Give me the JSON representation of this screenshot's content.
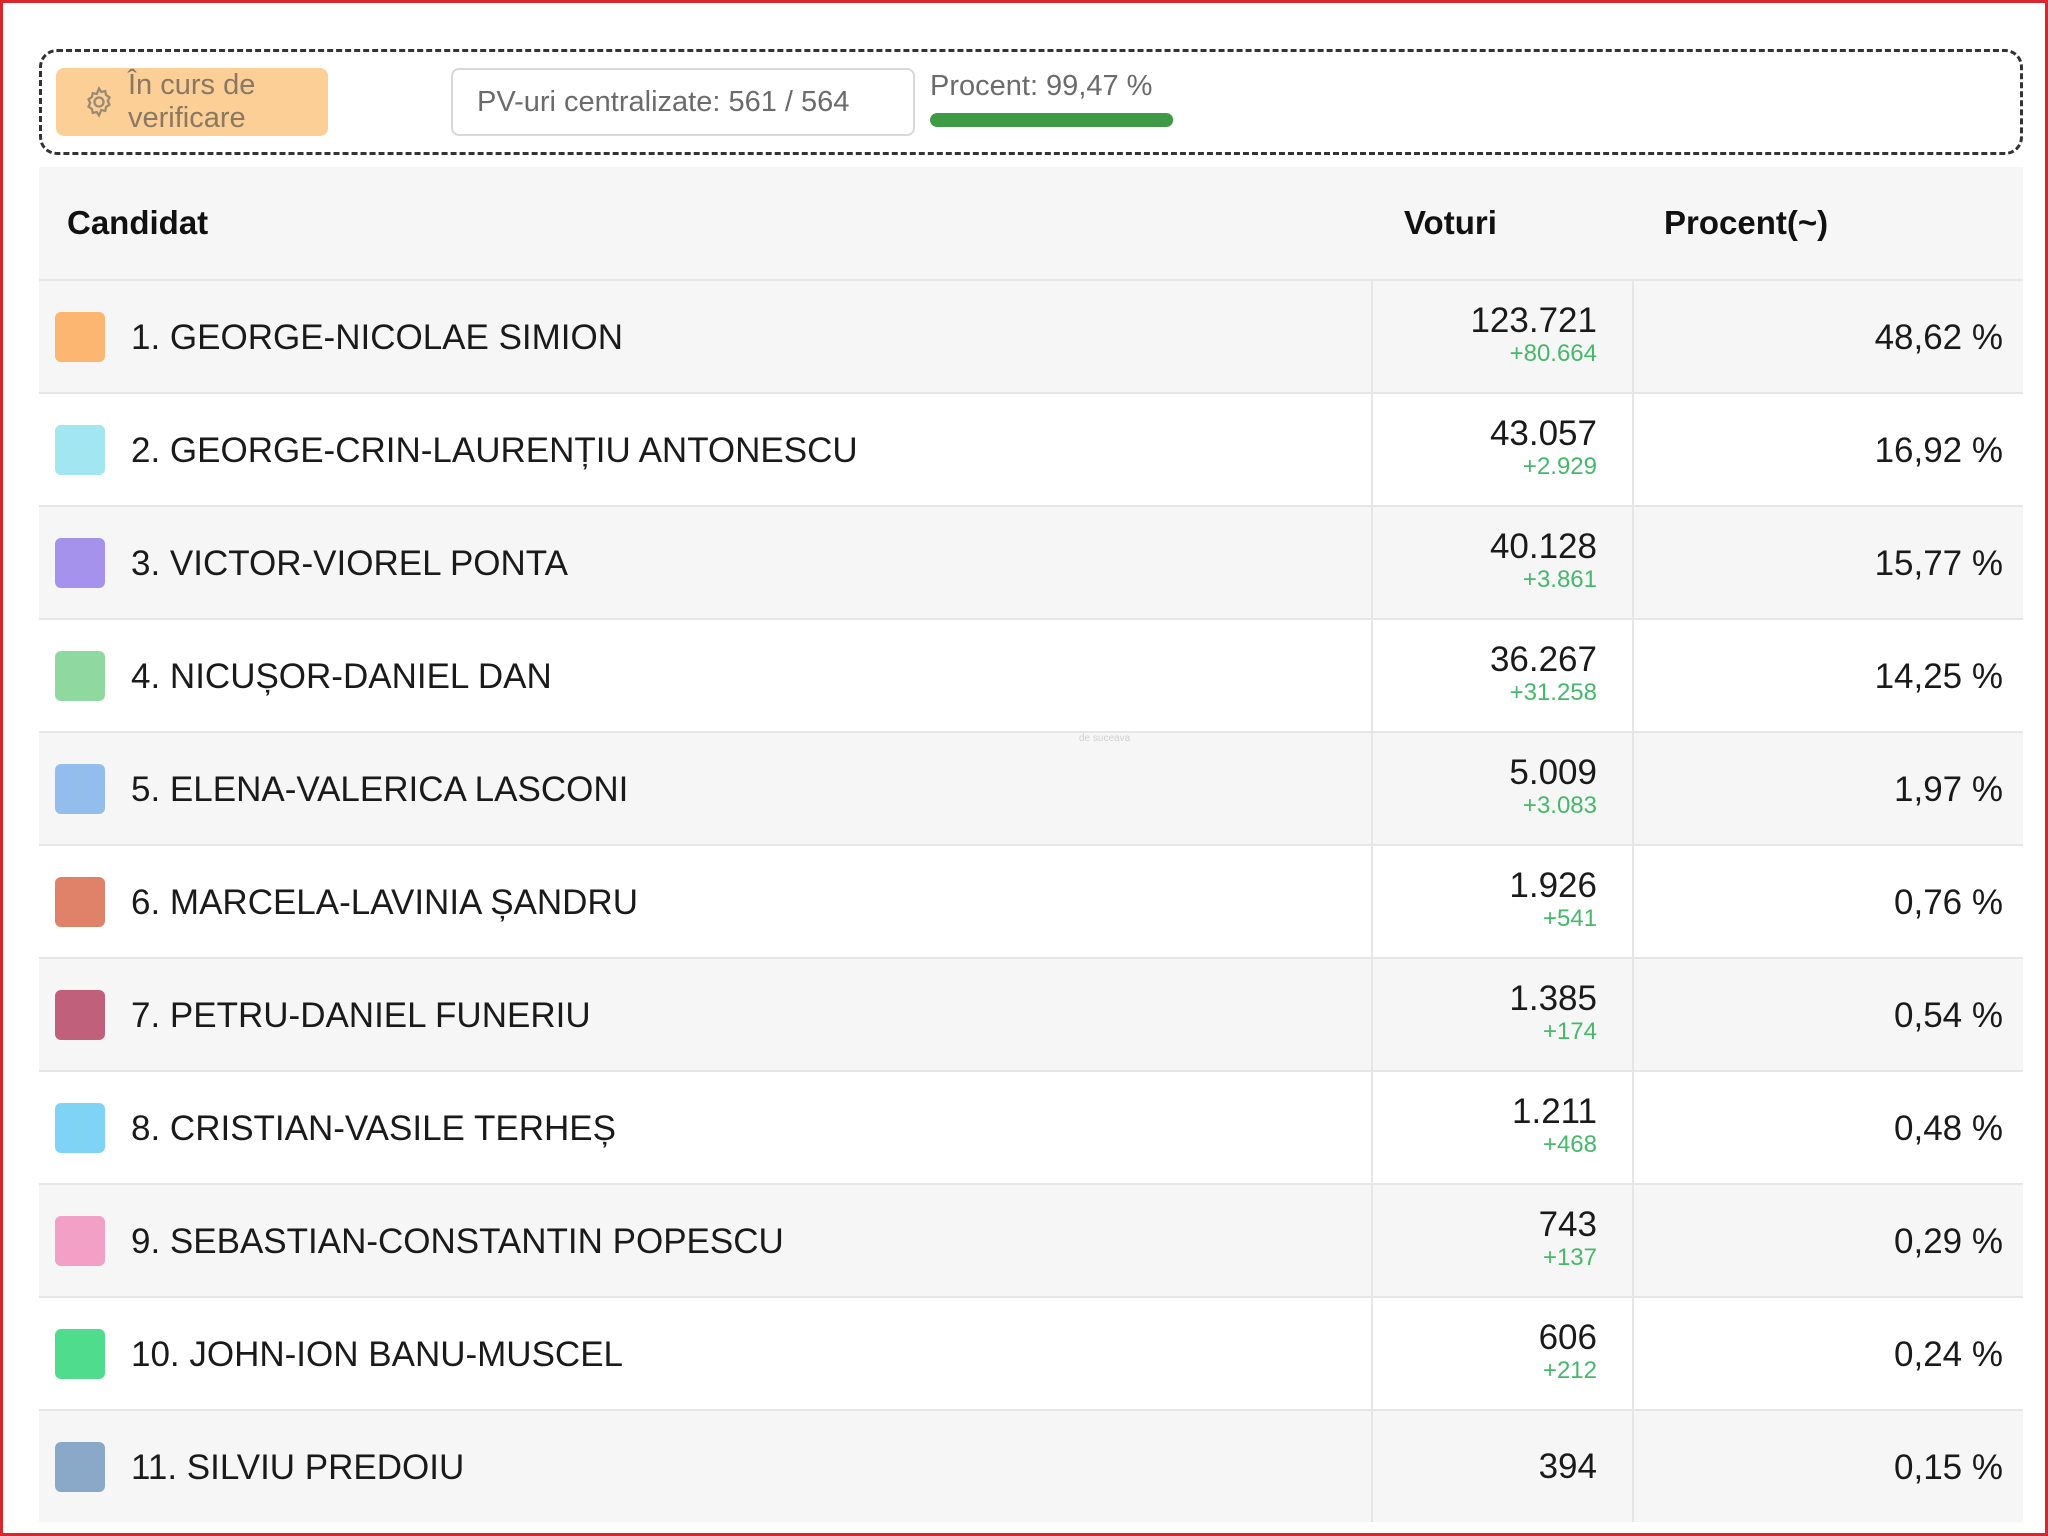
{
  "status": {
    "verify_label": "În curs de verificare",
    "verify_icon": "gear-icon",
    "pv_label": "PV-uri centralizate: 561 / 564",
    "procent_label": "Procent: 99,47 %",
    "procent_value": 0.9947
  },
  "table": {
    "headers": {
      "candidat": "Candidat",
      "voturi": "Voturi",
      "procent": "Procent(~)"
    },
    "rows": [
      {
        "name": "1. GEORGE-NICOLAE SIMION",
        "votes": "123.721",
        "delta": "+80.664",
        "percent": "48,62 %",
        "color": "#fcb672"
      },
      {
        "name": "2. GEORGE-CRIN-LAURENȚIU ANTONESCU",
        "votes": "43.057",
        "delta": "+2.929",
        "percent": "16,92 %",
        "color": "#a2e6f2"
      },
      {
        "name": "3. VICTOR-VIOREL PONTA",
        "votes": "40.128",
        "delta": "+3.861",
        "percent": "15,77 %",
        "color": "#a592ec"
      },
      {
        "name": "4. NICUȘOR-DANIEL DAN",
        "votes": "36.267",
        "delta": "+31.258",
        "percent": "14,25 %",
        "color": "#8fd9a0"
      },
      {
        "name": "5. ELENA-VALERICA LASCONI",
        "votes": "5.009",
        "delta": "+3.083",
        "percent": "1,97 %",
        "color": "#92bdec"
      },
      {
        "name": "6. MARCELA-LAVINIA ȘANDRU",
        "votes": "1.926",
        "delta": "+541",
        "percent": "0,76 %",
        "color": "#e0826a"
      },
      {
        "name": "7. PETRU-DANIEL FUNERIU",
        "votes": "1.385",
        "delta": "+174",
        "percent": "0,54 %",
        "color": "#c0607a"
      },
      {
        "name": "8. CRISTIAN-VASILE TERHEȘ",
        "votes": "1.211",
        "delta": "+468",
        "percent": "0,48 %",
        "color": "#7fd4f6"
      },
      {
        "name": "9. SEBASTIAN-CONSTANTIN POPESCU",
        "votes": "743",
        "delta": "+137",
        "percent": "0,29 %",
        "color": "#f3a0c6"
      },
      {
        "name": "10. JOHN-ION BANU-MUSCEL",
        "votes": "606",
        "delta": "+212",
        "percent": "0,24 %",
        "color": "#4fdc8c"
      },
      {
        "name": "11. SILVIU PREDOIU",
        "votes": "394",
        "delta": "",
        "percent": "0,15 %",
        "color": "#8aa8c8"
      }
    ]
  },
  "watermark": "de suceava"
}
